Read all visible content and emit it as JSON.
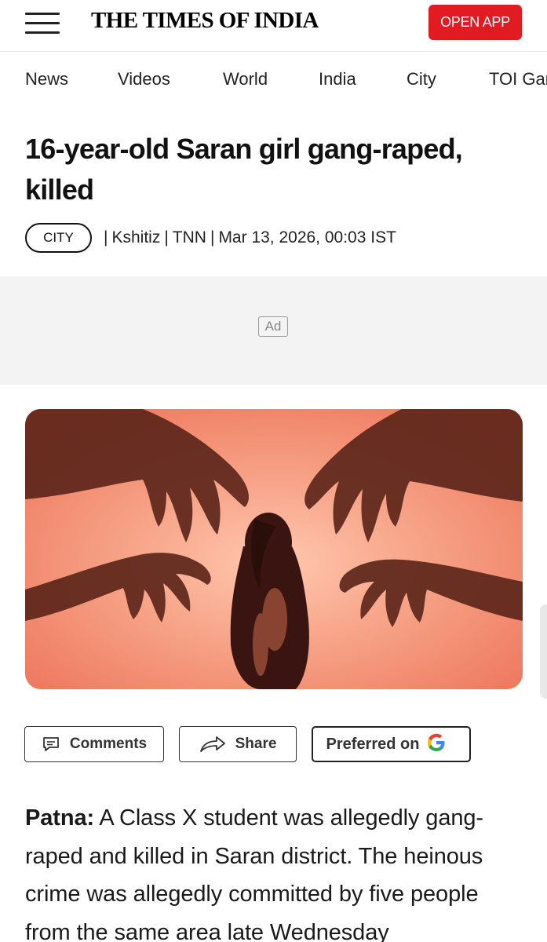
{
  "header": {
    "logo_text": "THE TIMES OF INDIA",
    "open_app_label": "OPEN APP",
    "open_app_color": "#e21b22"
  },
  "nav": {
    "items": [
      {
        "label": "News"
      },
      {
        "label": "Videos"
      },
      {
        "label": "World"
      },
      {
        "label": "India"
      },
      {
        "label": "City"
      },
      {
        "label": "TOI Games"
      }
    ]
  },
  "article": {
    "title": "16-year-old Saran girl gang-raped, killed",
    "category": "CITY",
    "author": "Kshitiz",
    "source": "TNN",
    "datetime": "Mar 13, 2026, 00:03 IST",
    "separator": "|",
    "ad_label": "Ad",
    "hero_image": {
      "accent_color": "#f08466",
      "shadow_color": "#4a1c12"
    },
    "actions": {
      "comments_label": "Comments",
      "share_label": "Share",
      "preferred_label": "Preferred on",
      "preferred_logo": "G"
    },
    "lead_dateline": "Patna:",
    "lead_text": "A Class X student was allegedly gang-raped and killed in Saran district. The heinous crime was allegedly committed by five people from the same area late Wednesday"
  }
}
